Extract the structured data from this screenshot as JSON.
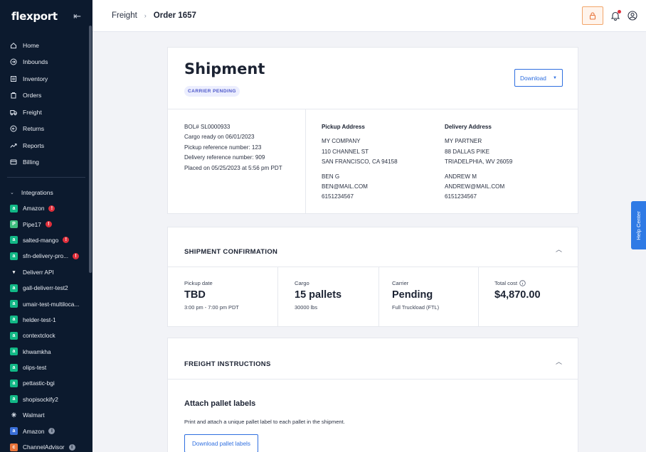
{
  "sidebar": {
    "logo": "flexport",
    "nav": [
      {
        "label": "Home",
        "icon": "home-icon"
      },
      {
        "label": "Inbounds",
        "icon": "inbounds-icon"
      },
      {
        "label": "Inventory",
        "icon": "inventory-icon"
      },
      {
        "label": "Orders",
        "icon": "orders-icon"
      },
      {
        "label": "Freight",
        "icon": "truck-icon"
      },
      {
        "label": "Returns",
        "icon": "returns-icon"
      },
      {
        "label": "Reports",
        "icon": "reports-icon"
      },
      {
        "label": "Billing",
        "icon": "billing-icon"
      }
    ],
    "integrations_label": "Integrations",
    "integrations": [
      {
        "label": "Amazon",
        "status": "error"
      },
      {
        "label": "Pipe17",
        "status": "error"
      },
      {
        "label": "salted-mango",
        "status": "error"
      },
      {
        "label": "sfn-delivery-pro...",
        "status": "error"
      },
      {
        "label": "Deliverr API",
        "status": ""
      },
      {
        "label": "gall-deliverr-test2",
        "status": ""
      },
      {
        "label": "umair-test-multiloca...",
        "status": ""
      },
      {
        "label": "helder-test-1",
        "status": ""
      },
      {
        "label": "contextclock",
        "status": ""
      },
      {
        "label": "khwamkha",
        "status": ""
      },
      {
        "label": "olips-test",
        "status": ""
      },
      {
        "label": "pettastic-bgi",
        "status": ""
      },
      {
        "label": "shopisockify2",
        "status": ""
      },
      {
        "label": "Walmart",
        "status": ""
      },
      {
        "label": "Amazon",
        "status": "info"
      },
      {
        "label": "ChannelAdvisor",
        "status": "info"
      }
    ]
  },
  "topbar": {
    "crumb_parent": "Freight",
    "crumb_separator": "›",
    "crumb_current": "Order 1657"
  },
  "shipment": {
    "title": "Shipment",
    "status": "CARRIER PENDING",
    "download_label": "Download",
    "details": [
      "BOL# SL0000933",
      "Cargo ready on 06/01/2023",
      "Pickup reference number: 123",
      "Delivery reference number: 909",
      "Placed on 05/25/2023 at 5:56 pm PDT"
    ],
    "pickup": {
      "heading": "Pickup Address",
      "company": "MY COMPANY",
      "street": "110 CHANNEL ST",
      "city": "SAN FRANCISCO, CA 94158",
      "contact": "BEN G",
      "email": "BEN@MAIL.COM",
      "phone": "6151234567"
    },
    "delivery": {
      "heading": "Delivery Address",
      "company": "MY PARTNER",
      "street": "88 DALLAS PIKE",
      "city": "TRIADELPHIA, WV 26059",
      "contact": "ANDREW M",
      "email": "ANDREW@MAIL.COM",
      "phone": "6151234567"
    }
  },
  "confirmation": {
    "heading": "SHIPMENT CONFIRMATION",
    "pickup_label": "Pickup date",
    "pickup_value": "TBD",
    "pickup_sub": "3:00 pm - 7:00 pm PDT",
    "cargo_label": "Cargo",
    "cargo_value": "15 pallets",
    "cargo_sub": "30000 lbs",
    "carrier_label": "Carrier",
    "carrier_value": "Pending",
    "carrier_sub": "Full Truckload (FTL)",
    "cost_label": "Total cost",
    "cost_value": "$4,870.00"
  },
  "freight": {
    "heading": "FREIGHT INSTRUCTIONS",
    "sub_title": "Attach pallet labels",
    "description": "Print and attach a unique pallet label to each pallet in the shipment.",
    "button_label": "Download pallet labels"
  },
  "help_center": "Help Center",
  "colors": {
    "sidebar_bg": "#0c1a2e",
    "accent": "#2f6fe0",
    "status_bg": "#eceefe",
    "status_text": "#4b56c9",
    "error": "#e02f3b",
    "lock_border": "#f2a56a"
  }
}
